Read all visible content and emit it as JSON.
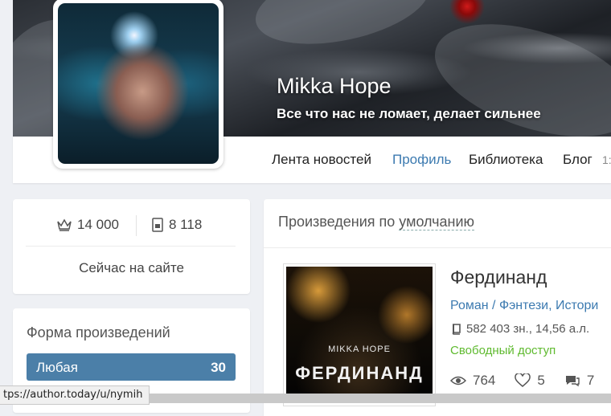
{
  "profile": {
    "name": "Mikka Hope",
    "slogan": "Все что нас не ломает, делает сильнее"
  },
  "nav": {
    "items": [
      {
        "label": "Лента новостей",
        "active": false
      },
      {
        "label": "Профиль",
        "active": true
      },
      {
        "label": "Библиотека",
        "active": false
      },
      {
        "label": "Блог",
        "active": false
      }
    ],
    "blog_count_partial": "1:"
  },
  "stats": {
    "rating": "14 000",
    "followers": "8 118",
    "online_status": "Сейчас на сайте"
  },
  "forms": {
    "title": "Форма произведений",
    "items": [
      {
        "label": "Любая",
        "count": "30"
      }
    ]
  },
  "works": {
    "title_prefix": "Произведения по ",
    "title_link": "умолчанию",
    "book": {
      "cover_author": "MIKKA HOPE",
      "cover_title": "ФЕРДИНАНД",
      "title": "Фердинанд",
      "genre1": "Роман",
      "sep": " / ",
      "genre2": "Фэнтези",
      "sep2": ", ",
      "genre3": "Истори",
      "size": "582 403 зн., 14,56 а.л.",
      "access": "Свободный доступ",
      "views": "764",
      "likes": "5",
      "comments": "7"
    }
  },
  "status_url": "tps://author.today/u/nymih",
  "colors": {
    "accent": "#3c7ab0",
    "active_filter": "#4b7fa8",
    "free_access": "#5fba2f"
  }
}
